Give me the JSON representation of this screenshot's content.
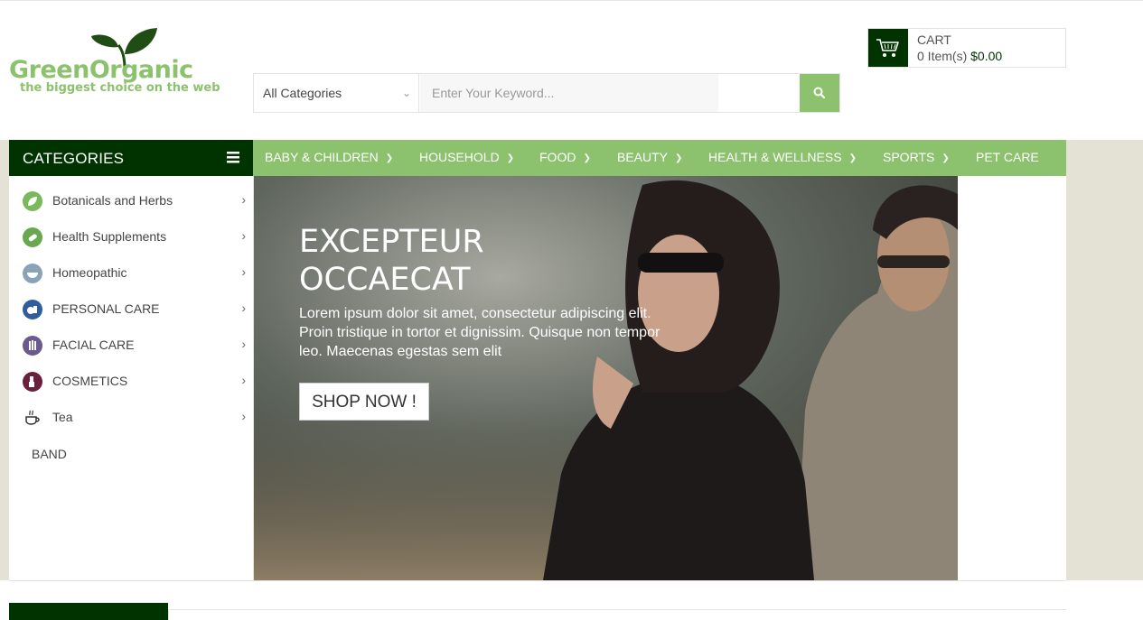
{
  "logo": {
    "name": "GreenOrganic",
    "tagline": "the biggest choice on the web"
  },
  "search": {
    "category_selected": "All Categories",
    "placeholder": "Enter Your Keyword...",
    "button_icon": "search-icon"
  },
  "cart": {
    "title": "CART",
    "items_text": "0 Item(s)",
    "total": "$0.00",
    "icon": "cart-icon"
  },
  "categories": {
    "header": "CATEGORIES",
    "menu_icon": "hamburger-icon",
    "items": [
      {
        "label": "Botanicals and Herbs",
        "icon": "leaf-icon",
        "icon_color": "#7ab85c"
      },
      {
        "label": "Health Supplements",
        "icon": "supplement-icon",
        "icon_color": "#6aa84f"
      },
      {
        "label": "Homeopathic",
        "icon": "mortar-icon",
        "icon_color": "#8aa3b8"
      },
      {
        "label": "PERSONAL CARE",
        "icon": "personal-care-icon",
        "icon_color": "#2f5d9e"
      },
      {
        "label": "FACIAL CARE",
        "icon": "facial-care-icon",
        "icon_color": "#6b5a8e"
      },
      {
        "label": "COSMETICS",
        "icon": "cosmetics-icon",
        "icon_color": "#6b1f3a"
      },
      {
        "label": "Tea",
        "icon": "tea-icon",
        "icon_color": "#333333"
      }
    ],
    "extra": "BAND"
  },
  "nav": {
    "items": [
      {
        "label": "BABY & CHILDREN",
        "has_dropdown": true
      },
      {
        "label": "HOUSEHOLD",
        "has_dropdown": true
      },
      {
        "label": "FOOD",
        "has_dropdown": true
      },
      {
        "label": "BEAUTY",
        "has_dropdown": true
      },
      {
        "label": "HEALTH & WELLNESS",
        "has_dropdown": true
      },
      {
        "label": "SPORTS",
        "has_dropdown": true
      },
      {
        "label": "PET CARE",
        "has_dropdown": false
      }
    ]
  },
  "banner": {
    "title_line1": "EXCEPTEUR",
    "title_line2": "OCCAECAT",
    "text": "Lorem ipsum dolor sit amet, consectetur adipiscing elit. Proin tristique in tortor et dignissim. Quisque non tempor leo. Maecenas egestas sem elit",
    "button": "SHOP NOW !"
  },
  "colors": {
    "brand_green": "#8cc26d",
    "dark_green": "#003300",
    "page_bg": "#e3e2d5"
  }
}
